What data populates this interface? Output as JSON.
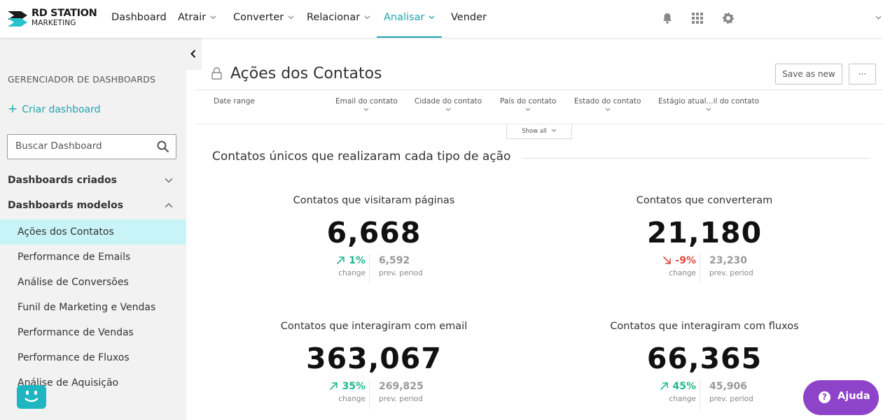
{
  "brand": {
    "line1": "RD STATION",
    "line2": "MARKETING"
  },
  "nav": [
    {
      "label": "Dashboard",
      "dropdown": false,
      "active": false
    },
    {
      "label": "Atrair",
      "dropdown": true,
      "active": false
    },
    {
      "label": "Converter",
      "dropdown": true,
      "active": false
    },
    {
      "label": "Relacionar",
      "dropdown": true,
      "active": false
    },
    {
      "label": "Analisar",
      "dropdown": true,
      "active": true
    },
    {
      "label": "Vender",
      "dropdown": false,
      "active": false
    }
  ],
  "topbar_icons": [
    "bell-icon",
    "apps-grid-icon",
    "gear-icon",
    "chevron-down-icon"
  ],
  "sidebar": {
    "title": "GERENCIADOR DE DASHBOARDS",
    "create_label": "Criar dashboard",
    "search_placeholder": "Buscar Dashboard",
    "groups": [
      {
        "label": "Dashboards criados",
        "expanded": false
      },
      {
        "label": "Dashboards modelos",
        "expanded": true
      }
    ],
    "items": [
      {
        "label": "Ações dos Contatos",
        "active": true
      },
      {
        "label": "Performance de Emails",
        "active": false
      },
      {
        "label": "Análise de Conversões",
        "active": false
      },
      {
        "label": "Funil de Marketing e Vendas",
        "active": false
      },
      {
        "label": "Performance de Vendas",
        "active": false
      },
      {
        "label": "Performance de Fluxos",
        "active": false
      },
      {
        "label": "Análise de Aquisição",
        "active": false
      }
    ]
  },
  "page": {
    "title": "Ações dos Contatos",
    "save_as_new": "Save as new",
    "more": "···",
    "filters": [
      "Date range",
      "Email do contato",
      "Cidade do contato",
      "País do contato",
      "Estado do contato",
      "Estágio atual...il do contato"
    ],
    "show_all": "Show all",
    "section_title": "Contatos únicos que realizaram cada tipo de ação"
  },
  "metrics": [
    {
      "title": "Contatos que visitaram páginas",
      "value": "6,668",
      "change": "1%",
      "direction": "up",
      "change_label": "change",
      "prev_value": "6,592",
      "prev_label": "prev. period"
    },
    {
      "title": "Contatos que converteram",
      "value": "21,180",
      "change": "-9%",
      "direction": "down",
      "change_label": "change",
      "prev_value": "23,230",
      "prev_label": "prev. period"
    },
    {
      "title": "Contatos que interagiram com email",
      "value": "363,067",
      "change": "35%",
      "direction": "up",
      "change_label": "change",
      "prev_value": "269,825",
      "prev_label": "prev. period"
    },
    {
      "title": "Contatos que interagiram com fluxos",
      "value": "66,365",
      "change": "45%",
      "direction": "up",
      "change_label": "change",
      "prev_value": "45,906",
      "prev_label": "prev. period"
    }
  ],
  "help": {
    "label": "Ajuda"
  },
  "colors": {
    "accent": "#1ea5ad",
    "positive": "#1fb88b",
    "negative": "#e0493c",
    "help": "#8e44c8",
    "active_item": "#c9f4f7"
  }
}
